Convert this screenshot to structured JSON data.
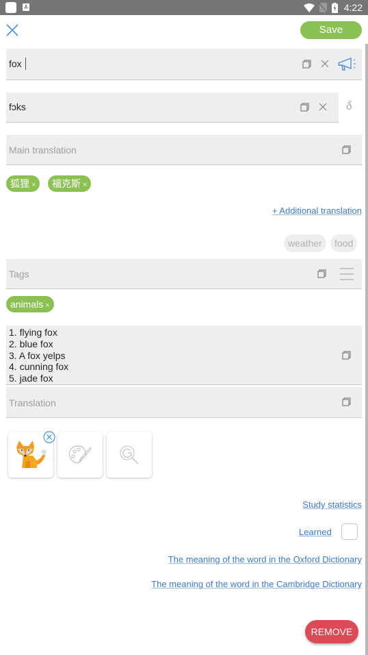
{
  "status_bar": {
    "time": "4:22",
    "icons": [
      "app-square-icon",
      "font-a-icon",
      "wifi-icon",
      "no-sim-icon",
      "battery-charging-icon"
    ],
    "a_glyph": "A"
  },
  "header": {
    "close_icon": "close-icon",
    "save_label": "Save"
  },
  "word": {
    "value": "fox",
    "icons": [
      "copy-icon",
      "clear-icon",
      "megaphone-icon"
    ]
  },
  "transcription": {
    "value": "fɔks",
    "icons": [
      "copy-icon",
      "clear-icon",
      "phonetic-symbol-icon"
    ],
    "phonetic_glyph": "ð̆"
  },
  "main_translation": {
    "placeholder": "Main translation",
    "chips": [
      {
        "label": "狐狸",
        "remove": "×"
      },
      {
        "label": "福克斯",
        "remove": "×"
      }
    ],
    "additional_link": "+ Additional translation"
  },
  "tags": {
    "suggestions": [
      "weather",
      "food"
    ],
    "placeholder": "Tags",
    "chips": [
      {
        "label": "animals",
        "remove": "×"
      }
    ]
  },
  "examples": {
    "lines": [
      "1. flying fox",
      "2. blue fox",
      "3. A fox yelps",
      "4. cunning fox",
      "5. jade fox"
    ]
  },
  "translation": {
    "placeholder": "Translation"
  },
  "images": [
    {
      "type": "fox-image",
      "removable": true
    },
    {
      "type": "palette-icon"
    },
    {
      "type": "google-search-icon"
    }
  ],
  "links": {
    "study_statistics": "Study statistics",
    "learned": "Learned",
    "oxford": "The meaning of the word in the Oxford Dictionary",
    "cambridge": "The meaning of the word in the Cambridge Dictionary"
  },
  "learned_checked": false,
  "remove_label": "REMOVE",
  "colors": {
    "accent_green": "#8bc152",
    "link_blue": "#3a7bd5",
    "remove_red": "#dd4a57",
    "field_bg": "#eeeeee",
    "status_bar": "#757575"
  }
}
